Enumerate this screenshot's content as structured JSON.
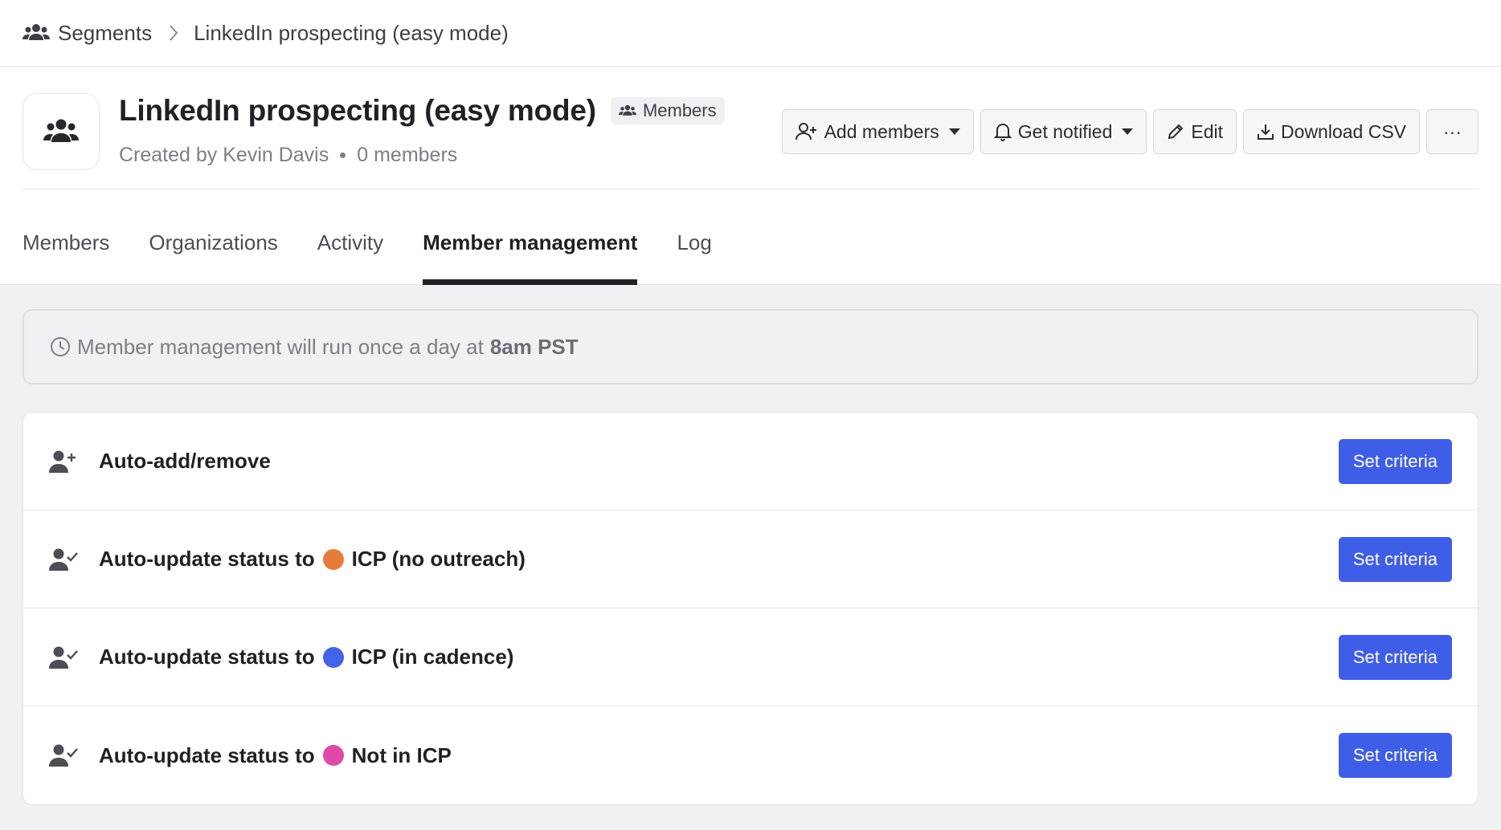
{
  "breadcrumb": {
    "root": "Segments",
    "current": "LinkedIn prospecting (easy mode)"
  },
  "header": {
    "title": "LinkedIn prospecting (easy mode)",
    "badge": "Members",
    "created_by": "Created by Kevin Davis",
    "member_count": "0 members"
  },
  "actions": {
    "add_members": "Add members",
    "get_notified": "Get notified",
    "edit": "Edit",
    "download_csv": "Download CSV",
    "more": "···"
  },
  "tabs": [
    {
      "label": "Members",
      "active": false
    },
    {
      "label": "Organizations",
      "active": false
    },
    {
      "label": "Activity",
      "active": false
    },
    {
      "label": "Member management",
      "active": true
    },
    {
      "label": "Log",
      "active": false
    }
  ],
  "notice": {
    "text": "Member management will run once a day at",
    "time": "8am PST"
  },
  "rules": [
    {
      "label": "Auto-add/remove",
      "status": "",
      "color": "",
      "icon": "user-plus-icon",
      "button": "Set criteria"
    },
    {
      "label": "Auto-update status to",
      "status": "ICP (no outreach)",
      "color": "#e67c3c",
      "icon": "user-check-icon",
      "button": "Set criteria"
    },
    {
      "label": "Auto-update status to",
      "status": "ICP (in cadence)",
      "color": "#4563e8",
      "icon": "user-check-icon",
      "button": "Set criteria"
    },
    {
      "label": "Auto-update status to",
      "status": "Not in ICP",
      "color": "#dd4aa8",
      "icon": "user-check-icon",
      "button": "Set criteria"
    }
  ]
}
